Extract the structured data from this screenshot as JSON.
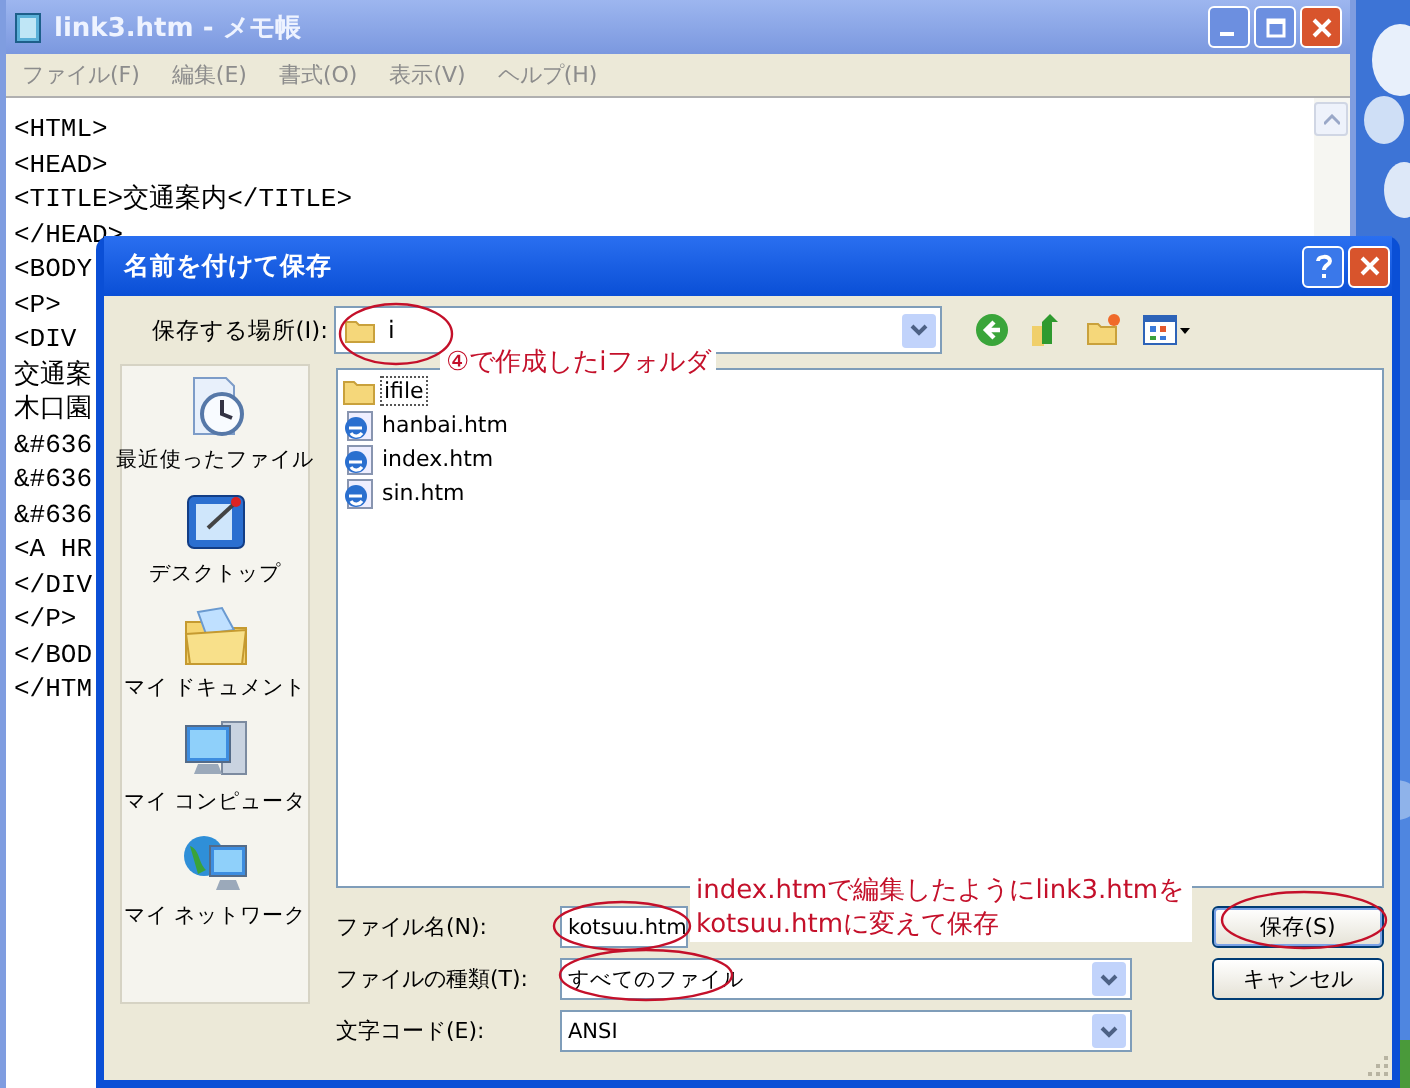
{
  "notepad": {
    "title": "link3.htm - メモ帳",
    "menu": [
      "ファイル(F)",
      "編集(E)",
      "書式(O)",
      "表示(V)",
      "ヘルプ(H)"
    ],
    "lines": [
      "<HTML>",
      "<HEAD>",
      "<TITLE>交通案内</TITLE>",
      "</HEAD>",
      "<BODY",
      "<P>",
      "<DIV",
      "交通案",
      "木口園",
      "&#636",
      "&#636",
      "&#636",
      "<A HR",
      "</DIV",
      "</P>",
      "</BOD",
      "</HTM"
    ]
  },
  "dialog": {
    "title": "名前を付けて保存",
    "save_in": {
      "label": "保存する場所(I):",
      "value": "i"
    },
    "places": [
      {
        "label": "最近使ったファイル",
        "kind": "recent"
      },
      {
        "label": "デスクトップ",
        "kind": "desktop"
      },
      {
        "label": "マイ ドキュメント",
        "kind": "documents"
      },
      {
        "label": "マイ コンピュータ",
        "kind": "computer"
      },
      {
        "label": "マイ ネットワーク",
        "kind": "network"
      }
    ],
    "files": [
      {
        "name": "ifile",
        "kind": "folder",
        "focused": true
      },
      {
        "name": "hanbai.htm",
        "kind": "htm",
        "focused": false
      },
      {
        "name": "index.htm",
        "kind": "htm",
        "focused": false
      },
      {
        "name": "sin.htm",
        "kind": "htm",
        "focused": false
      }
    ],
    "fields": [
      {
        "label": "ファイル名(N):",
        "value": "kotsuu.htm",
        "kind": "text"
      },
      {
        "label": "ファイルの種類(T):",
        "value": "すべてのファイル",
        "kind": "combo"
      },
      {
        "label": "文字コード(E):",
        "value": "ANSI",
        "kind": "combo"
      }
    ],
    "buttons": [
      {
        "label": "保存(S)",
        "default": true
      },
      {
        "label": "キャンセル",
        "default": false
      }
    ],
    "annotations": [
      {
        "lines": [
          "④で作成したiフォルダ"
        ]
      },
      {
        "lines": [
          "index.htmで編集したようにlink3.htmを",
          "kotsuu.htmに変えて保存"
        ]
      }
    ]
  }
}
